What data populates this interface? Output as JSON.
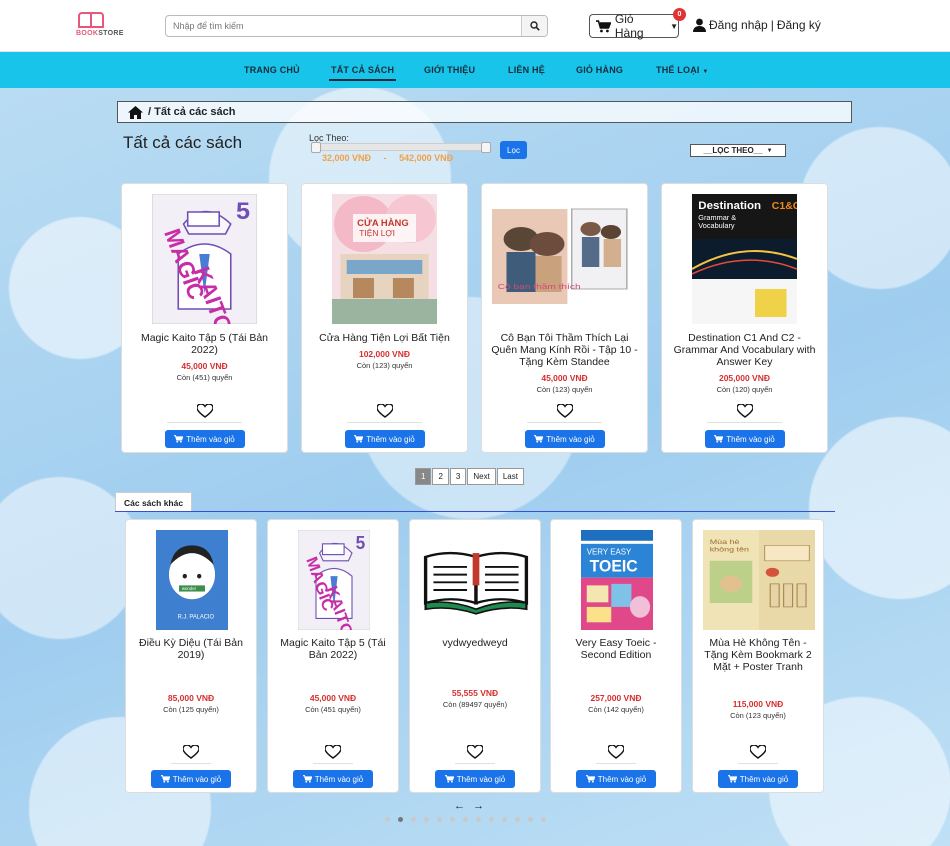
{
  "brand": {
    "logo_text_pink": "BOOK",
    "logo_text_gray": "STORE"
  },
  "search": {
    "placeholder": "Nhập để tìm kiếm"
  },
  "cart": {
    "label": "Giỏ Hàng",
    "count": "0"
  },
  "account": {
    "login": "Đăng nhập",
    "separator": "|",
    "register": "Đăng ký"
  },
  "nav": {
    "items": [
      {
        "label": "TRANG CHỦ"
      },
      {
        "label": "TẤT CẢ SÁCH"
      },
      {
        "label": "GIỚI THIỆU"
      },
      {
        "label": "LIÊN HỆ"
      },
      {
        "label": "GIỎ HÀNG"
      },
      {
        "label": "THỂ LOẠI"
      }
    ],
    "active_index": 1
  },
  "breadcrumb": {
    "current": "/ Tất cả các sách"
  },
  "page": {
    "title": "Tất cả các sách"
  },
  "filter": {
    "label": "Lọc Theo:",
    "min_price": "32,000 VNĐ",
    "separator": "-",
    "max_price": "542,000 VNĐ",
    "button": "Lọc",
    "sort_label": "__LỌC THEO__"
  },
  "products": [
    {
      "name": "Magic Kaito Tập 5 (Tái Bản 2022)",
      "price": "45,000 VNĐ",
      "stock": "Còn (451) quyển",
      "button": "Thêm vào giỏ",
      "cover": "magic-kaito"
    },
    {
      "name": "Cửa Hàng Tiện Lợi Bất Tiện",
      "price": "102,000 VNĐ",
      "stock": "Còn (123) quyển",
      "button": "Thêm vào giỏ",
      "cover": "cua-hang"
    },
    {
      "name": "Cô Bạn Tôi Thầm Thích Lại Quên Mang Kính Rồi - Tập 10 - Tặng Kèm Standee",
      "price": "45,000 VNĐ",
      "stock": "Còn (123) quyển",
      "button": "Thêm vào giỏ",
      "cover": "co-ban"
    },
    {
      "name": "Destination C1 And C2 - Grammar And Vocabulary with Answer Key",
      "price": "205,000 VNĐ",
      "stock": "Còn (120) quyển",
      "button": "Thêm vào giỏ",
      "cover": "destination"
    }
  ],
  "pagination": {
    "pages": [
      "1",
      "2",
      "3"
    ],
    "next": "Next",
    "last": "Last",
    "current": "1"
  },
  "other_books": {
    "tab": "Các sách khác",
    "items": [
      {
        "name": "Điều Kỳ Diệu (Tái Bản 2019)",
        "price": "85,000 VNĐ",
        "stock": "Còn (125 quyển)",
        "button": "Thêm vào giỏ",
        "cover": "wonder"
      },
      {
        "name": "Magic Kaito Tập 5 (Tái Bản 2022)",
        "price": "45,000 VNĐ",
        "stock": "Còn (451 quyển)",
        "button": "Thêm vào giỏ",
        "cover": "magic-kaito"
      },
      {
        "name": "vydwyedweyd",
        "price": "55,555 VNĐ",
        "stock": "Còn (89497 quyển)",
        "button": "Thêm vào giỏ",
        "cover": "open-book"
      },
      {
        "name": "Very Easy Toeic - Second Edition",
        "price": "257,000 VNĐ",
        "stock": "Còn (142 quyển)",
        "button": "Thêm vào giỏ",
        "cover": "toeic"
      },
      {
        "name": "Mùa Hè Không Tên - Tặng Kèm Bookmark 2 Mặt + Poster Tranh",
        "price": "115,000 VNĐ",
        "stock": "Còn (123 quyển)",
        "button": "Thêm vào giỏ",
        "cover": "mua-he"
      }
    ],
    "prev_arrow": "←",
    "next_arrow": "→",
    "dot_count": 13,
    "active_dot": 1
  },
  "colors": {
    "nav_bg": "#18c4ea",
    "accent": "#1a73e8",
    "price": "#d62f2f",
    "range": "#f0a04a",
    "badge": "#e03434"
  }
}
